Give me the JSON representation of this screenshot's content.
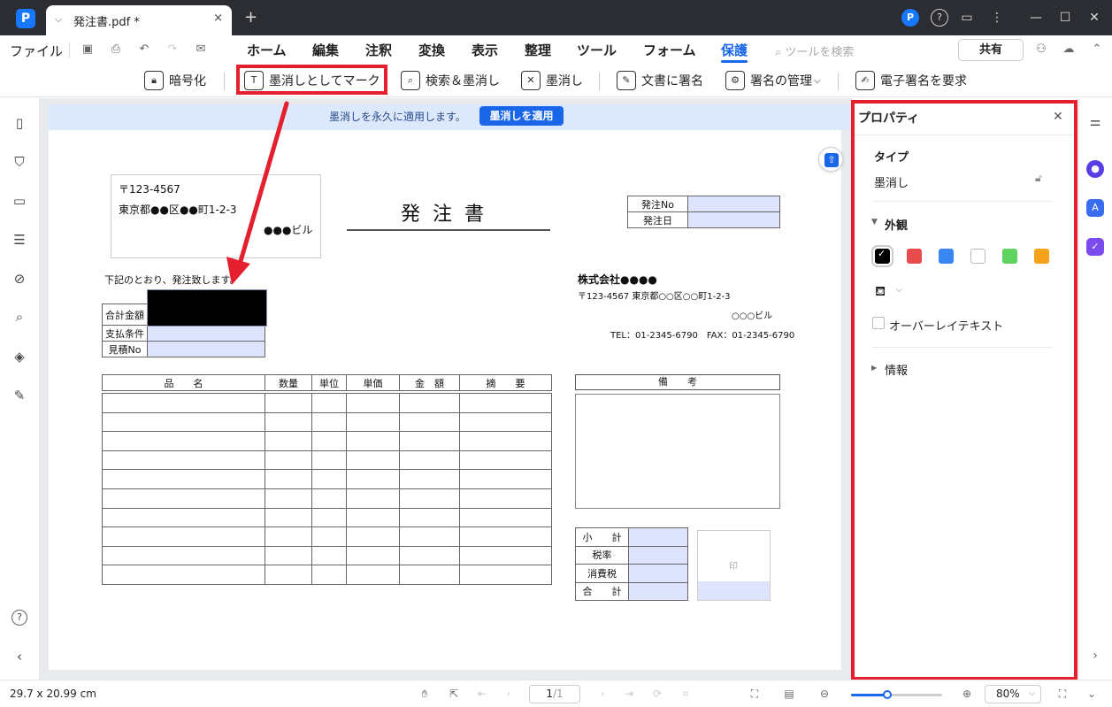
{
  "titlebar": {
    "tab_title": "発注書.pdf *",
    "icons": [
      "app-logo-icon",
      "chevron-down-icon",
      "close-icon",
      "plus-icon",
      "avatar-icon",
      "help-icon",
      "feedback-icon",
      "more-icon",
      "minimize-icon",
      "maximize-icon",
      "window-close-icon"
    ],
    "avatar_letter": "P",
    "close_glyph": "×",
    "new_tab_glyph": "+"
  },
  "menubar": {
    "file": "ファイル",
    "items": [
      "ホーム",
      "編集",
      "注釈",
      "変換",
      "表示",
      "整理",
      "ツール",
      "フォーム",
      "保護"
    ],
    "active": "保護",
    "search_placeholder": "ツールを検索",
    "share": "共有"
  },
  "toolbar": {
    "tools": [
      "暗号化",
      "墨消しとしてマーク",
      "検索＆墨消し",
      "墨消し",
      "文書に署名",
      "署名の管理",
      "電子署名を要求"
    ],
    "highlighted": "墨消しとしてマーク"
  },
  "banner": {
    "message": "墨消しを永久に適用します。",
    "apply_button": "墨消しを適用"
  },
  "document": {
    "postal": "〒123-4567",
    "address": "東京都●●区●●町1-2-3",
    "building": "●●●ビル",
    "title": "発注書",
    "order_no_label": "発注No",
    "order_date_label": "発注日",
    "intro": "下記のとおり、発注致します。",
    "total_label": "合計金額",
    "payment_label": "支払条件",
    "quote_label": "見積No",
    "company": "株式会社●●●●",
    "company_address": "〒123-4567 東京都○○区○○町1-2-3",
    "company_building": "○○○ビル",
    "company_contact": "TEL：01-2345-6790　FAX：01-2345-6790",
    "columns": [
      "品　　名",
      "数量",
      "単位",
      "単価",
      "金　額",
      "摘　　要"
    ],
    "remarks_label": "備　　考",
    "summary_labels": [
      "小　　計",
      "税率",
      "消費税",
      "合　　計"
    ],
    "stamp_mark": "印"
  },
  "properties": {
    "title": "プロパティ",
    "type_heading": "タイプ",
    "type_value": "墨消し",
    "appearance": "外観",
    "colors": [
      "#000000",
      "#e84c4c",
      "#3a86f5",
      "#ffffff",
      "#5fd35f",
      "#f5a21a"
    ],
    "selected_color": "#000000",
    "overlay_text": "オーバーレイテキスト",
    "info": "情報"
  },
  "statusbar": {
    "dimensions": "29.7 x 20.99 cm",
    "page": "1",
    "page_total": "/1",
    "zoom": "80%",
    "zoom_fraction": 0.4
  },
  "accent": "#1a66e8",
  "annotation_color": "#e5202e"
}
